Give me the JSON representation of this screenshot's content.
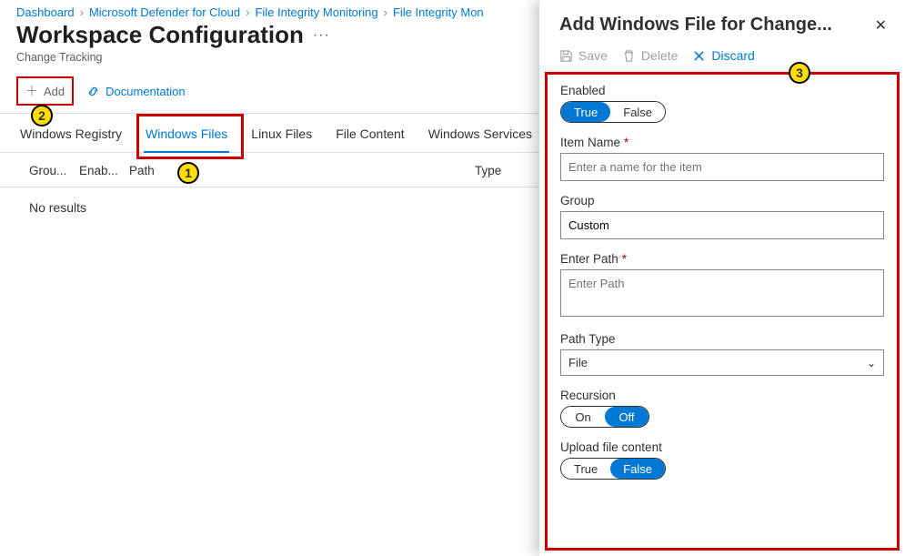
{
  "breadcrumbs": {
    "dashboard": "Dashboard",
    "defender": "Microsoft Defender for Cloud",
    "fim": "File Integrity Monitoring",
    "fim2": "File Integrity Mon"
  },
  "page": {
    "title": "Workspace Configuration",
    "subtitle": "Change Tracking"
  },
  "toolbar": {
    "add": "Add",
    "documentation": "Documentation"
  },
  "tabs": {
    "registry": "Windows Registry",
    "winfiles": "Windows Files",
    "linuxfiles": "Linux Files",
    "filecontent": "File Content",
    "winservices": "Windows Services"
  },
  "table": {
    "col_group": "Grou...",
    "col_enab": "Enab...",
    "col_path": "Path",
    "col_type": "Type",
    "no_results": "No results"
  },
  "callouts": {
    "c1": "1",
    "c2": "2",
    "c3": "3"
  },
  "panel": {
    "title": "Add Windows File for Change...",
    "save": "Save",
    "delete": "Delete",
    "discard": "Discard",
    "enabled_label": "Enabled",
    "enabled_true": "True",
    "enabled_false": "False",
    "item_name_label": "Item Name",
    "item_name_placeholder": "Enter a name for the item",
    "group_label": "Group",
    "group_value": "Custom",
    "enter_path_label": "Enter Path",
    "enter_path_placeholder": "Enter Path",
    "path_type_label": "Path Type",
    "path_type_value": "File",
    "recursion_label": "Recursion",
    "recursion_on": "On",
    "recursion_off": "Off",
    "upload_label": "Upload file content",
    "upload_true": "True",
    "upload_false": "False"
  }
}
